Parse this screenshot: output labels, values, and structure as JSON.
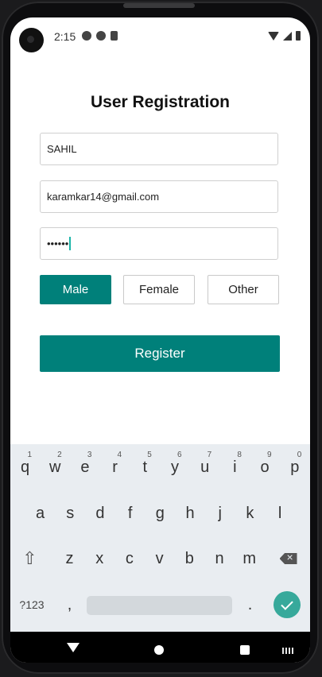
{
  "status_bar": {
    "time": "2:15"
  },
  "form": {
    "title": "User Registration",
    "name_value": "SAHIL",
    "email_value": "karamkar14@gmail.com",
    "password_mask": "••••••",
    "gender_options": [
      "Male",
      "Female",
      "Other"
    ],
    "selected_gender": "Male",
    "register_label": "Register"
  },
  "keyboard": {
    "row1": [
      "q",
      "w",
      "e",
      "r",
      "t",
      "y",
      "u",
      "i",
      "o",
      "p"
    ],
    "row1_hints": [
      "1",
      "2",
      "3",
      "4",
      "5",
      "6",
      "7",
      "8",
      "9",
      "0"
    ],
    "row2": [
      "a",
      "s",
      "d",
      "f",
      "g",
      "h",
      "j",
      "k",
      "l"
    ],
    "row3": [
      "z",
      "x",
      "c",
      "v",
      "b",
      "n",
      "m"
    ],
    "symbols_label": "?123",
    "comma": ",",
    "period": "."
  },
  "colors": {
    "accent": "#00807a",
    "keyboard_done": "#37a99b"
  },
  "icons": [
    "shift-icon",
    "backspace-icon",
    "checkmark-icon",
    "nav-back-icon",
    "nav-home-icon",
    "nav-recents-icon",
    "keyboard-switch-icon"
  ]
}
